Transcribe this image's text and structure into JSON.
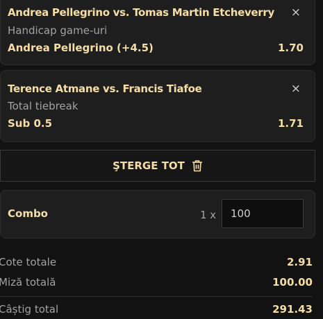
{
  "bets": [
    {
      "match": "Andrea Pellegrino vs. Tomas Martin Etcheverry",
      "market": "Handicap game-uri",
      "selection": "Andrea Pellegrino (+4.5)",
      "odds": "1.70"
    },
    {
      "match": "Terence Atmane vs. Francis Tiafoe",
      "market": "Total tiebreak",
      "selection": "Sub 0.5",
      "odds": "1.71"
    }
  ],
  "close_symbol": "×",
  "clear_all_label": "ŞTERGE TOT",
  "combo": {
    "label": "Combo",
    "multiplier": "1 x",
    "stake": "100"
  },
  "summary": {
    "total_odds_label": "Cote totale",
    "total_odds": "2.91",
    "total_stake_label": "Miză totală",
    "total_stake": "100.00",
    "total_win_label": "Câștig total",
    "total_win": "291.43"
  }
}
